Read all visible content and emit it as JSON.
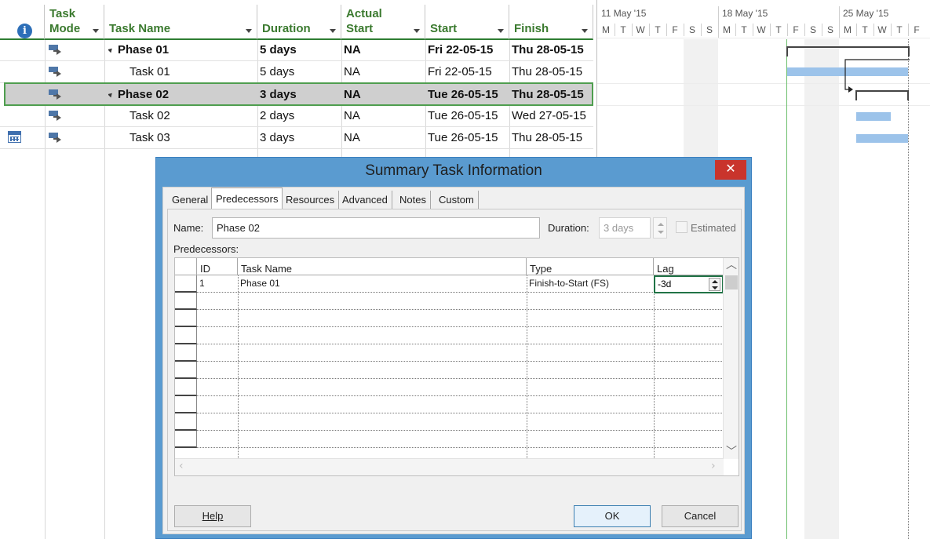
{
  "sheet": {
    "headers": {
      "info_symbol": "i",
      "task_mode": "Task\nMode",
      "task_name": "Task Name",
      "duration": "Duration",
      "actual_start": "Actual\nStart",
      "start": "Start",
      "finish": "Finish"
    },
    "rows": [
      {
        "name": "Phase 01",
        "summary": true,
        "duration": "5 days",
        "actual_start": "NA",
        "start": "Fri 22-05-15",
        "finish": "Thu 28-05-15"
      },
      {
        "name": "Task 01",
        "summary": false,
        "duration": "5 days",
        "actual_start": "NA",
        "start": "Fri 22-05-15",
        "finish": "Thu 28-05-15"
      },
      {
        "name": "Phase 02",
        "summary": true,
        "duration": "3 days",
        "actual_start": "NA",
        "start": "Tue 26-05-15",
        "finish": "Thu 28-05-15"
      },
      {
        "name": "Task 02",
        "summary": false,
        "duration": "2 days",
        "actual_start": "NA",
        "start": "Tue 26-05-15",
        "finish": "Wed 27-05-15"
      },
      {
        "name": "Task 03",
        "summary": false,
        "duration": "3 days",
        "actual_start": "NA",
        "start": "Tue 26-05-15",
        "finish": "Thu 28-05-15"
      }
    ]
  },
  "gantt": {
    "weeks": [
      "11 May '15",
      "18 May '15",
      "25 May '15"
    ],
    "days": [
      "M",
      "T",
      "W",
      "T",
      "F",
      "S",
      "S",
      "M",
      "T",
      "W",
      "T",
      "F",
      "S",
      "S",
      "M",
      "T",
      "W",
      "T",
      "F"
    ],
    "colors": {
      "bar": "#9cc3ea",
      "today_line": "#6cbf6c"
    }
  },
  "dialog": {
    "title": "Summary Task Information",
    "close_symbol": "✕",
    "tabs": [
      "General",
      "Predecessors",
      "Resources",
      "Advanced",
      "Notes",
      "Custom Fields"
    ],
    "active_tab": "Predecessors",
    "name_label": "Name:",
    "name_value": "Phase 02",
    "duration_label": "Duration:",
    "duration_value": "3 days",
    "estimated_label": "Estimated",
    "predecessors_label": "Predecessors:",
    "grid_headers": [
      "ID",
      "Task Name",
      "Type",
      "Lag"
    ],
    "grid_rows": [
      {
        "id": "1",
        "task_name": "Phase 01",
        "type": "Finish-to-Start (FS)",
        "lag": "-3d"
      }
    ],
    "help_button": "Help",
    "ok_button": "OK",
    "cancel_button": "Cancel",
    "colors": {
      "title_bar": "#5a9bd0",
      "close": "#c9342c"
    }
  }
}
